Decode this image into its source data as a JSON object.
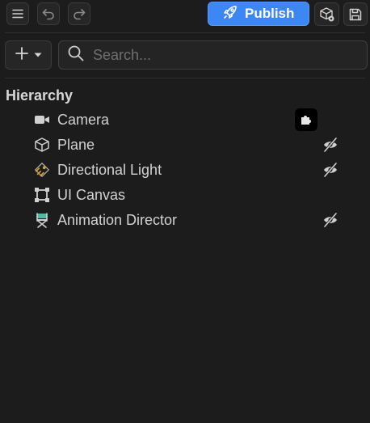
{
  "toolbar": {
    "menu_icon": "hamburger-menu-icon",
    "undo_icon": "undo-icon",
    "redo_icon": "redo-icon",
    "publish_label": "Publish",
    "publish_icon": "rocket-icon",
    "package_icon": "package-settings-icon",
    "save_icon": "save-icon",
    "accent_color": "#3d87f5"
  },
  "search": {
    "placeholder": "Search...",
    "value": ""
  },
  "hierarchy": {
    "title": "Hierarchy",
    "items": [
      {
        "label": "Camera",
        "icon": "camera-icon",
        "right_icon": "component-badge-icon"
      },
      {
        "label": "Plane",
        "icon": "cube-icon",
        "right_icon": "visibility-off-icon"
      },
      {
        "label": "Directional Light",
        "icon": "directional-light-icon",
        "right_icon": "visibility-off-icon"
      },
      {
        "label": "UI Canvas",
        "icon": "ui-canvas-icon",
        "right_icon": ""
      },
      {
        "label": "Animation Director",
        "icon": "director-chair-icon",
        "right_icon": "visibility-off-icon"
      }
    ]
  }
}
